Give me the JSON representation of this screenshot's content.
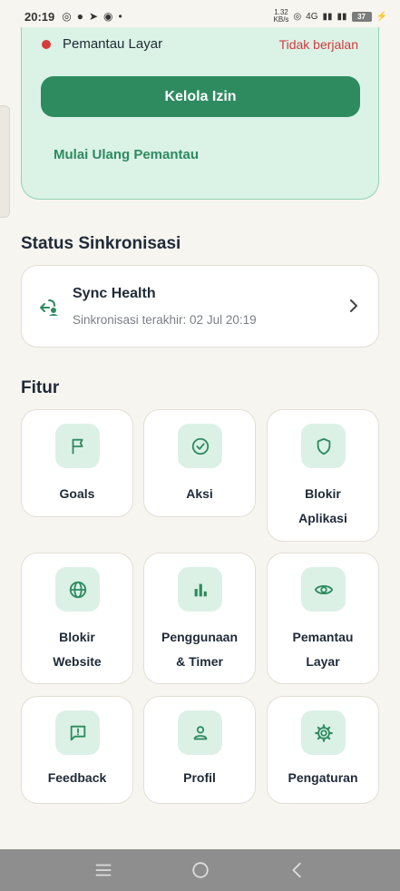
{
  "status_bar": {
    "time": "20:19",
    "speed_top": "1.32",
    "speed_bottom": "KB/s",
    "network": "4G",
    "battery": "37"
  },
  "monitor": {
    "label": "Pemantau Layar",
    "status": "Tidak berjalan",
    "status_color": "#d03b3b",
    "manage_button": "Kelola Izin",
    "restart_link": "Mulai Ulang Pemantau"
  },
  "sync": {
    "section_title": "Status Sinkronisasi",
    "title": "Sync Health",
    "subtitle": "Sinkronisasi terakhir: 02 Jul 20:19"
  },
  "features": {
    "section_title": "Fitur",
    "items": [
      {
        "line1": "Goals",
        "line2": "",
        "icon": "flag-icon"
      },
      {
        "line1": "Aksi",
        "line2": "",
        "icon": "check-circle-icon"
      },
      {
        "line1": "Blokir",
        "line2": "Aplikasi",
        "icon": "shield-icon"
      },
      {
        "line1": "Blokir",
        "line2": "Website",
        "icon": "globe-icon"
      },
      {
        "line1": "Penggunaan",
        "line2": "& Timer",
        "icon": "bar-chart-icon"
      },
      {
        "line1": "Pemantau",
        "line2": "Layar",
        "icon": "eye-icon"
      },
      {
        "line1": "Feedback",
        "line2": "",
        "icon": "feedback-icon"
      },
      {
        "line1": "Profil",
        "line2": "",
        "icon": "person-icon"
      },
      {
        "line1": "Pengaturan",
        "line2": "",
        "icon": "gear-icon"
      }
    ]
  },
  "colors": {
    "accent": "#2e8b60",
    "panel_bg": "#dbf2e7",
    "icon_bg": "#dcf1e6",
    "background": "#f7f5f0"
  }
}
